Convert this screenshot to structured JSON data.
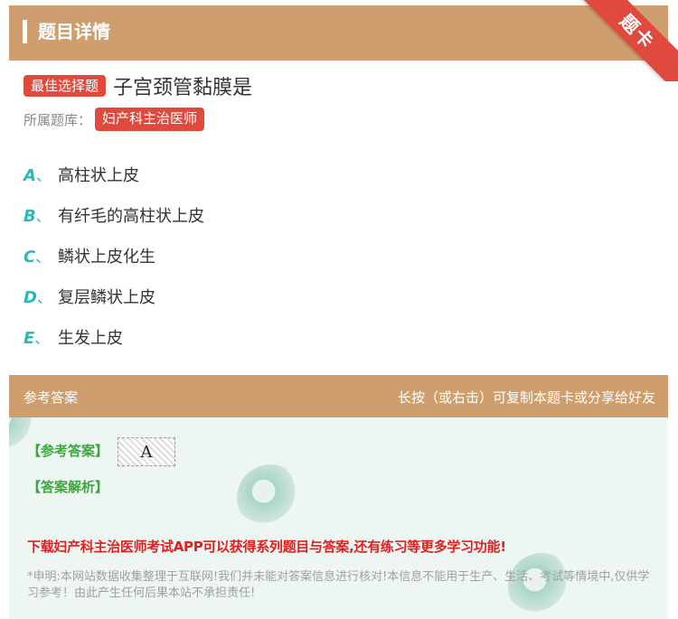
{
  "header": {
    "title": "题目详情"
  },
  "corner_ribbon": {
    "label": "题卡"
  },
  "question": {
    "type_tag": "最佳选择题",
    "text": "子宫颈管黏膜是",
    "category_label": "所属题库：",
    "category": "妇产科主治医师"
  },
  "options": [
    {
      "letter": "A",
      "sep": "、",
      "text": "高柱状上皮"
    },
    {
      "letter": "B",
      "sep": "、",
      "text": "有纤毛的高柱状上皮"
    },
    {
      "letter": "C",
      "sep": "、",
      "text": "鳞状上皮化生"
    },
    {
      "letter": "D",
      "sep": "、",
      "text": "复层鳞状上皮"
    },
    {
      "letter": "E",
      "sep": "、",
      "text": "生发上皮"
    }
  ],
  "answer_section": {
    "title": "参考答案",
    "hint": "长按（或右击）可复制本题卡或分享给好友",
    "answer_label": "【参考答案】",
    "answer_value": "A",
    "analysis_label": "【答案解析】",
    "promo": "下载妇产科主治医师考试APP可以获得系列题目与答案,还有练习等更多学习功能!",
    "disclaimer": "*申明:本网站数据收集整理于互联网!我们并未能对答案信息进行核对!本信息不能用于生产、生活、考试等情境中,仅供学习参考！由此产生任何后果本站不承担责任!"
  },
  "colors": {
    "header_bg": "#cf9e6e",
    "tag_red": "#e04a3e",
    "option_letter": "#2fb7b7",
    "answer_green": "#3aa83a",
    "promo_red": "#e02020"
  }
}
